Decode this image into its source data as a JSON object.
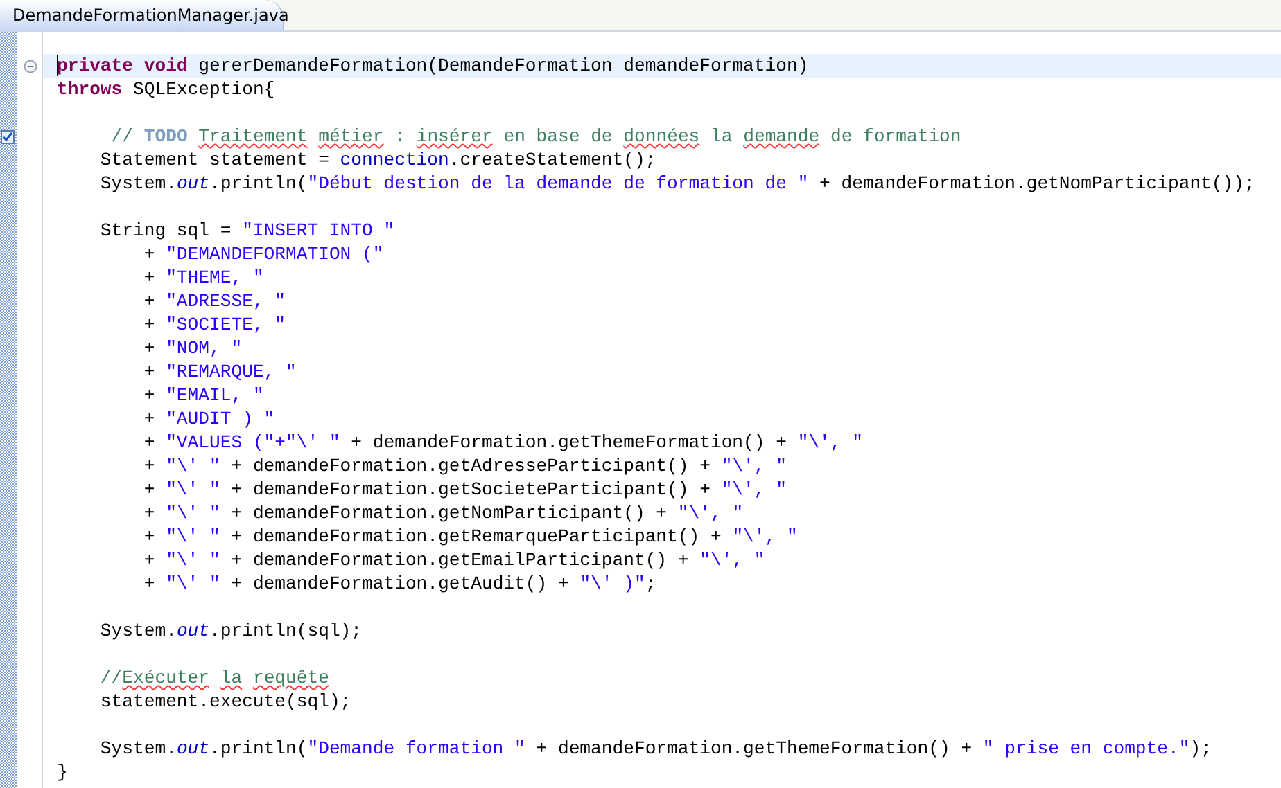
{
  "tab": {
    "title": "DemandeFormationManager.java",
    "selected": true
  },
  "editor": {
    "lines": [
      {
        "kind": "code",
        "current": true,
        "fold": true,
        "task": false,
        "tokens": [
          {
            "kind": "keyword",
            "text": "private void"
          },
          {
            "kind": "plain",
            "text": " gererDemandeFormation(DemandeFormation demandeFormation)"
          }
        ]
      },
      {
        "kind": "code",
        "current": false,
        "fold": false,
        "task": false,
        "tokens": [
          {
            "kind": "keyword",
            "text": "throws"
          },
          {
            "kind": "plain",
            "text": " SQLException{"
          }
        ]
      },
      {
        "kind": "blank"
      },
      {
        "kind": "code",
        "current": false,
        "fold": false,
        "task": true,
        "tokens": [
          {
            "kind": "comment",
            "text": "     // "
          },
          {
            "kind": "todo",
            "text": "TODO",
            "space_after": true
          },
          {
            "kind": "misspelled",
            "text": "Traitement",
            "space_after": true
          },
          {
            "kind": "misspelled",
            "text": "métier"
          },
          {
            "kind": "comment",
            "text": " : "
          },
          {
            "kind": "misspelled",
            "text": "insérer"
          },
          {
            "kind": "comment",
            "text": " en base de "
          },
          {
            "kind": "misspelled",
            "text": "données"
          },
          {
            "kind": "comment",
            "text": " la "
          },
          {
            "kind": "misspelled",
            "text": "demande"
          },
          {
            "kind": "comment",
            "text": " de formation"
          }
        ]
      },
      {
        "kind": "code",
        "current": false,
        "fold": false,
        "task": false,
        "tokens": [
          {
            "kind": "plain",
            "text": "    Statement statement = "
          },
          {
            "kind": "field",
            "text": "connection"
          },
          {
            "kind": "plain",
            "text": ".createStatement();"
          }
        ]
      },
      {
        "kind": "code",
        "current": false,
        "fold": false,
        "task": false,
        "tokens": [
          {
            "kind": "plain",
            "text": "    System."
          },
          {
            "kind": "static",
            "text": "out"
          },
          {
            "kind": "plain",
            "text": ".println("
          },
          {
            "kind": "string",
            "text": "\"Début destion de la demande de formation de \""
          },
          {
            "kind": "plain",
            "text": " + demandeFormation.getNomParticipant());"
          }
        ]
      },
      {
        "kind": "blank"
      },
      {
        "kind": "code",
        "current": false,
        "fold": false,
        "task": false,
        "tokens": [
          {
            "kind": "plain",
            "text": "    String sql = "
          },
          {
            "kind": "string",
            "text": "\"INSERT INTO \""
          }
        ]
      },
      {
        "kind": "code",
        "current": false,
        "fold": false,
        "task": false,
        "tokens": [
          {
            "kind": "plain",
            "text": "        + "
          },
          {
            "kind": "string",
            "text": "\"DEMANDEFORMATION (\""
          }
        ]
      },
      {
        "kind": "code",
        "current": false,
        "fold": false,
        "task": false,
        "tokens": [
          {
            "kind": "plain",
            "text": "        + "
          },
          {
            "kind": "string",
            "text": "\"THEME, \""
          }
        ]
      },
      {
        "kind": "code",
        "current": false,
        "fold": false,
        "task": false,
        "tokens": [
          {
            "kind": "plain",
            "text": "        + "
          },
          {
            "kind": "string",
            "text": "\"ADRESSE, \""
          }
        ]
      },
      {
        "kind": "code",
        "current": false,
        "fold": false,
        "task": false,
        "tokens": [
          {
            "kind": "plain",
            "text": "        + "
          },
          {
            "kind": "string",
            "text": "\"SOCIETE, \""
          }
        ]
      },
      {
        "kind": "code",
        "current": false,
        "fold": false,
        "task": false,
        "tokens": [
          {
            "kind": "plain",
            "text": "        + "
          },
          {
            "kind": "string",
            "text": "\"NOM, \""
          }
        ]
      },
      {
        "kind": "code",
        "current": false,
        "fold": false,
        "task": false,
        "tokens": [
          {
            "kind": "plain",
            "text": "        + "
          },
          {
            "kind": "string",
            "text": "\"REMARQUE, \""
          }
        ]
      },
      {
        "kind": "code",
        "current": false,
        "fold": false,
        "task": false,
        "tokens": [
          {
            "kind": "plain",
            "text": "        + "
          },
          {
            "kind": "string",
            "text": "\"EMAIL, \""
          }
        ]
      },
      {
        "kind": "code",
        "current": false,
        "fold": false,
        "task": false,
        "tokens": [
          {
            "kind": "plain",
            "text": "        + "
          },
          {
            "kind": "string",
            "text": "\"AUDIT ) \""
          }
        ]
      },
      {
        "kind": "code",
        "current": false,
        "fold": false,
        "task": false,
        "tokens": [
          {
            "kind": "plain",
            "text": "        + "
          },
          {
            "kind": "string",
            "text": "\"VALUES (\"+\"\\' \""
          },
          {
            "kind": "plain",
            "text": " + demandeFormation.getThemeFormation() + "
          },
          {
            "kind": "string",
            "text": "\"\\', \""
          }
        ]
      },
      {
        "kind": "code",
        "current": false,
        "fold": false,
        "task": false,
        "tokens": [
          {
            "kind": "plain",
            "text": "        + "
          },
          {
            "kind": "string",
            "text": "\"\\' \""
          },
          {
            "kind": "plain",
            "text": " + demandeFormation.getAdresseParticipant() + "
          },
          {
            "kind": "string",
            "text": "\"\\', \""
          }
        ]
      },
      {
        "kind": "code",
        "current": false,
        "fold": false,
        "task": false,
        "tokens": [
          {
            "kind": "plain",
            "text": "        + "
          },
          {
            "kind": "string",
            "text": "\"\\' \""
          },
          {
            "kind": "plain",
            "text": " + demandeFormation.getSocieteParticipant() + "
          },
          {
            "kind": "string",
            "text": "\"\\', \""
          }
        ]
      },
      {
        "kind": "code",
        "current": false,
        "fold": false,
        "task": false,
        "tokens": [
          {
            "kind": "plain",
            "text": "        + "
          },
          {
            "kind": "string",
            "text": "\"\\' \""
          },
          {
            "kind": "plain",
            "text": " + demandeFormation.getNomParticipant() + "
          },
          {
            "kind": "string",
            "text": "\"\\', \""
          }
        ]
      },
      {
        "kind": "code",
        "current": false,
        "fold": false,
        "task": false,
        "tokens": [
          {
            "kind": "plain",
            "text": "        + "
          },
          {
            "kind": "string",
            "text": "\"\\' \""
          },
          {
            "kind": "plain",
            "text": " + demandeFormation.getRemarqueParticipant() + "
          },
          {
            "kind": "string",
            "text": "\"\\', \""
          }
        ]
      },
      {
        "kind": "code",
        "current": false,
        "fold": false,
        "task": false,
        "tokens": [
          {
            "kind": "plain",
            "text": "        + "
          },
          {
            "kind": "string",
            "text": "\"\\' \""
          },
          {
            "kind": "plain",
            "text": " + demandeFormation.getEmailParticipant() + "
          },
          {
            "kind": "string",
            "text": "\"\\', \""
          }
        ]
      },
      {
        "kind": "code",
        "current": false,
        "fold": false,
        "task": false,
        "tokens": [
          {
            "kind": "plain",
            "text": "        + "
          },
          {
            "kind": "string",
            "text": "\"\\' \""
          },
          {
            "kind": "plain",
            "text": " + demandeFormation.getAudit() + "
          },
          {
            "kind": "string",
            "text": "\"\\' )\""
          },
          {
            "kind": "plain",
            "text": ";"
          }
        ]
      },
      {
        "kind": "blank"
      },
      {
        "kind": "code",
        "current": false,
        "fold": false,
        "task": false,
        "tokens": [
          {
            "kind": "plain",
            "text": "    System."
          },
          {
            "kind": "static",
            "text": "out"
          },
          {
            "kind": "plain",
            "text": ".println(sql);"
          }
        ]
      },
      {
        "kind": "blank"
      },
      {
        "kind": "code",
        "current": false,
        "fold": false,
        "task": false,
        "tokens": [
          {
            "kind": "comment",
            "text": "    //"
          },
          {
            "kind": "misspelled",
            "text": "Exécuter",
            "space_after": true
          },
          {
            "kind": "misspelled",
            "text": "la",
            "space_after": true
          },
          {
            "kind": "misspelled",
            "text": "requête"
          }
        ]
      },
      {
        "kind": "code",
        "current": false,
        "fold": false,
        "task": false,
        "tokens": [
          {
            "kind": "plain",
            "text": "    statement.execute(sql);"
          }
        ]
      },
      {
        "kind": "blank"
      },
      {
        "kind": "code",
        "current": false,
        "fold": false,
        "task": false,
        "tokens": [
          {
            "kind": "plain",
            "text": "    System."
          },
          {
            "kind": "static",
            "text": "out"
          },
          {
            "kind": "plain",
            "text": ".println("
          },
          {
            "kind": "string",
            "text": "\"Demande formation \""
          },
          {
            "kind": "plain",
            "text": " + demandeFormation.getThemeFormation() + "
          },
          {
            "kind": "string",
            "text": "\" prise en compte.\""
          },
          {
            "kind": "plain",
            "text": ");"
          }
        ]
      },
      {
        "kind": "code",
        "current": false,
        "fold": false,
        "task": false,
        "tokens": [
          {
            "kind": "plain",
            "text": "}"
          }
        ]
      }
    ]
  }
}
